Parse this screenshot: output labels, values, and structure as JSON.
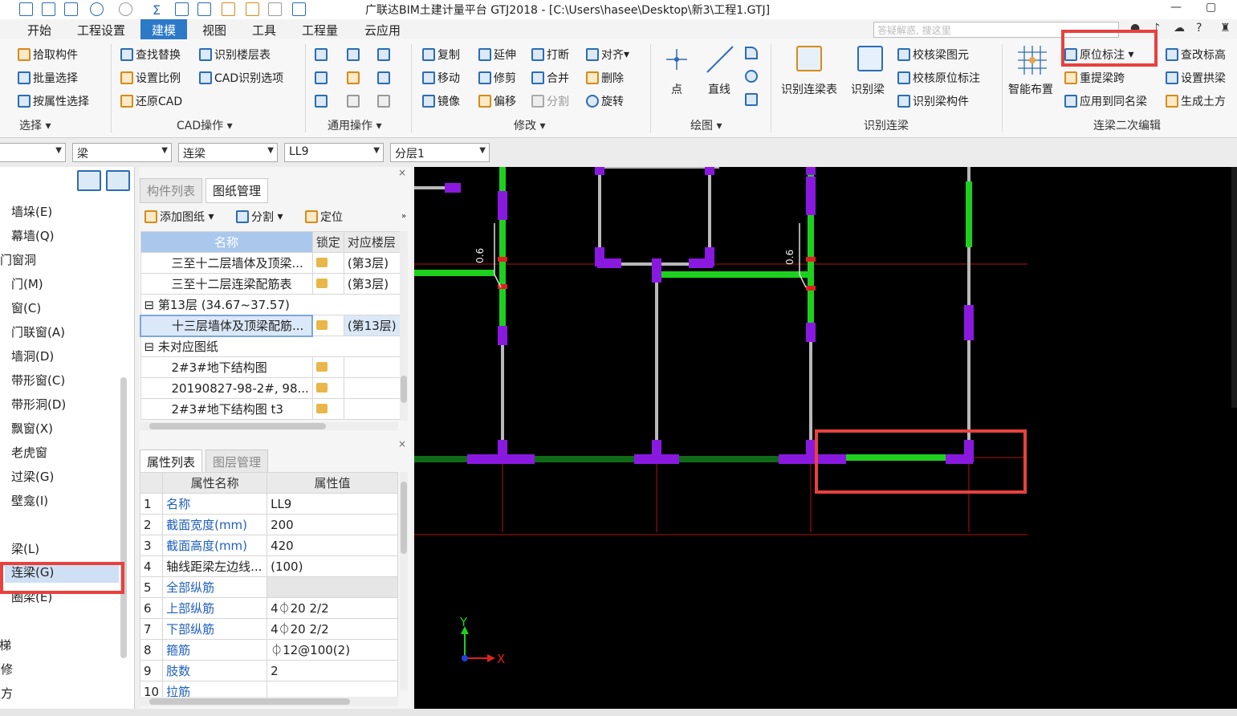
{
  "window": {
    "title": "广联达BIM土建计量平台 GTJ2018 - [C:\\Users\\hasee\\Desktop\\新3\\工程1.GTJ]"
  },
  "menu": {
    "items": [
      "开始",
      "工程设置",
      "建模",
      "视图",
      "工具",
      "工程量",
      "云应用"
    ],
    "active": "建模"
  },
  "help_search": {
    "placeholder": "答疑解惑, 搜这里"
  },
  "ribbon": {
    "select": {
      "items": [
        "拾取构件",
        "批量选择",
        "按属性选择"
      ],
      "group": "选择"
    },
    "cad": {
      "items": [
        "查找替换",
        "识别楼层表",
        "设置比例",
        "CAD识别选项",
        "还原CAD"
      ],
      "group": "CAD操作"
    },
    "common": {
      "group": "通用操作"
    },
    "modify": {
      "items": [
        "复制",
        "延伸",
        "打断",
        "对齐",
        "移动",
        "修剪",
        "合并",
        "删除",
        "镜像",
        "偏移",
        "分割",
        "旋转"
      ],
      "group": "修改"
    },
    "draw": {
      "items": [
        "点",
        "直线"
      ],
      "group": "绘图"
    },
    "recog": {
      "items": [
        "识别连梁表",
        "识别梁",
        "校核梁图元",
        "校核原位标注",
        "识别梁构件"
      ],
      "group": "识别连梁"
    },
    "secondary": {
      "items": [
        "智能布置",
        "原位标注",
        "查改标高",
        "重提梁跨",
        "设置拱梁",
        "应用到同名梁",
        "生成土方"
      ],
      "group": "连梁二次编辑"
    }
  },
  "combos": {
    "c1": "梁",
    "c2": "连梁",
    "c3": "LL9",
    "c4": "分层1"
  },
  "left_tree": {
    "items": [
      "墙垛(E)",
      "幕墙(Q)",
      "门窗洞",
      "门(M)",
      "窗(C)",
      "门联窗(A)",
      "墙洞(D)",
      "带形窗(C)",
      "带形洞(D)",
      "飘窗(X)",
      "老虎窗",
      "过梁(G)",
      "壁龛(I)",
      "梁(L)",
      "连梁(G)",
      "圈梁(E)",
      "楼梯",
      "装修",
      "土方"
    ],
    "selected": "连梁(G)"
  },
  "drawing_panel": {
    "tabs": [
      "构件列表",
      "图纸管理"
    ],
    "toolbar": [
      "添加图纸",
      "分割",
      "定位"
    ],
    "headers": [
      "名称",
      "锁定",
      "对应楼层"
    ],
    "rows": [
      {
        "name": "三至十二层墙体及顶梁...",
        "floor": "(第3层)"
      },
      {
        "name": "三至十二层连梁配筋表",
        "floor": "(第3层)"
      },
      {
        "name": "第13层 (34.67~37.57)",
        "floor": ""
      },
      {
        "name": "十三层墙体及顶梁配筋...",
        "floor": "(第13层)"
      },
      {
        "name": "未对应图纸",
        "floor": ""
      },
      {
        "name": "2#3#地下结构图",
        "floor": ""
      },
      {
        "name": "20190827-98-2#, 98...",
        "floor": ""
      },
      {
        "name": "2#3#地下结构图 t3",
        "floor": ""
      }
    ]
  },
  "property_panel": {
    "tabs": [
      "属性列表",
      "图层管理"
    ],
    "headers": [
      "属性名称",
      "属性值"
    ],
    "rows": [
      {
        "no": "1",
        "name": "名称",
        "value": "LL9"
      },
      {
        "no": "2",
        "name": "截面宽度(mm)",
        "value": "200"
      },
      {
        "no": "3",
        "name": "截面高度(mm)",
        "value": "420"
      },
      {
        "no": "4",
        "name": "轴线距梁左边线...",
        "value": "(100)"
      },
      {
        "no": "5",
        "name": "全部纵筋",
        "value": ""
      },
      {
        "no": "6",
        "name": "上部纵筋",
        "value": "4⏀20 2/2"
      },
      {
        "no": "7",
        "name": "下部纵筋",
        "value": "4⏀20 2/2"
      },
      {
        "no": "8",
        "name": "箍筋",
        "value": "⏀12@100(2)"
      },
      {
        "no": "9",
        "name": "肢数",
        "value": "2"
      },
      {
        "no": "10",
        "name": "拉筋",
        "value": ""
      }
    ]
  },
  "canvas": {
    "axis_x": "X",
    "axis_y": "Y",
    "beam_label": "0.6"
  },
  "colors": {
    "accent": "#2c79c8",
    "highlight": "#e8413f",
    "beam_green": "#1ed01e",
    "column_purple": "#8a19e0"
  }
}
